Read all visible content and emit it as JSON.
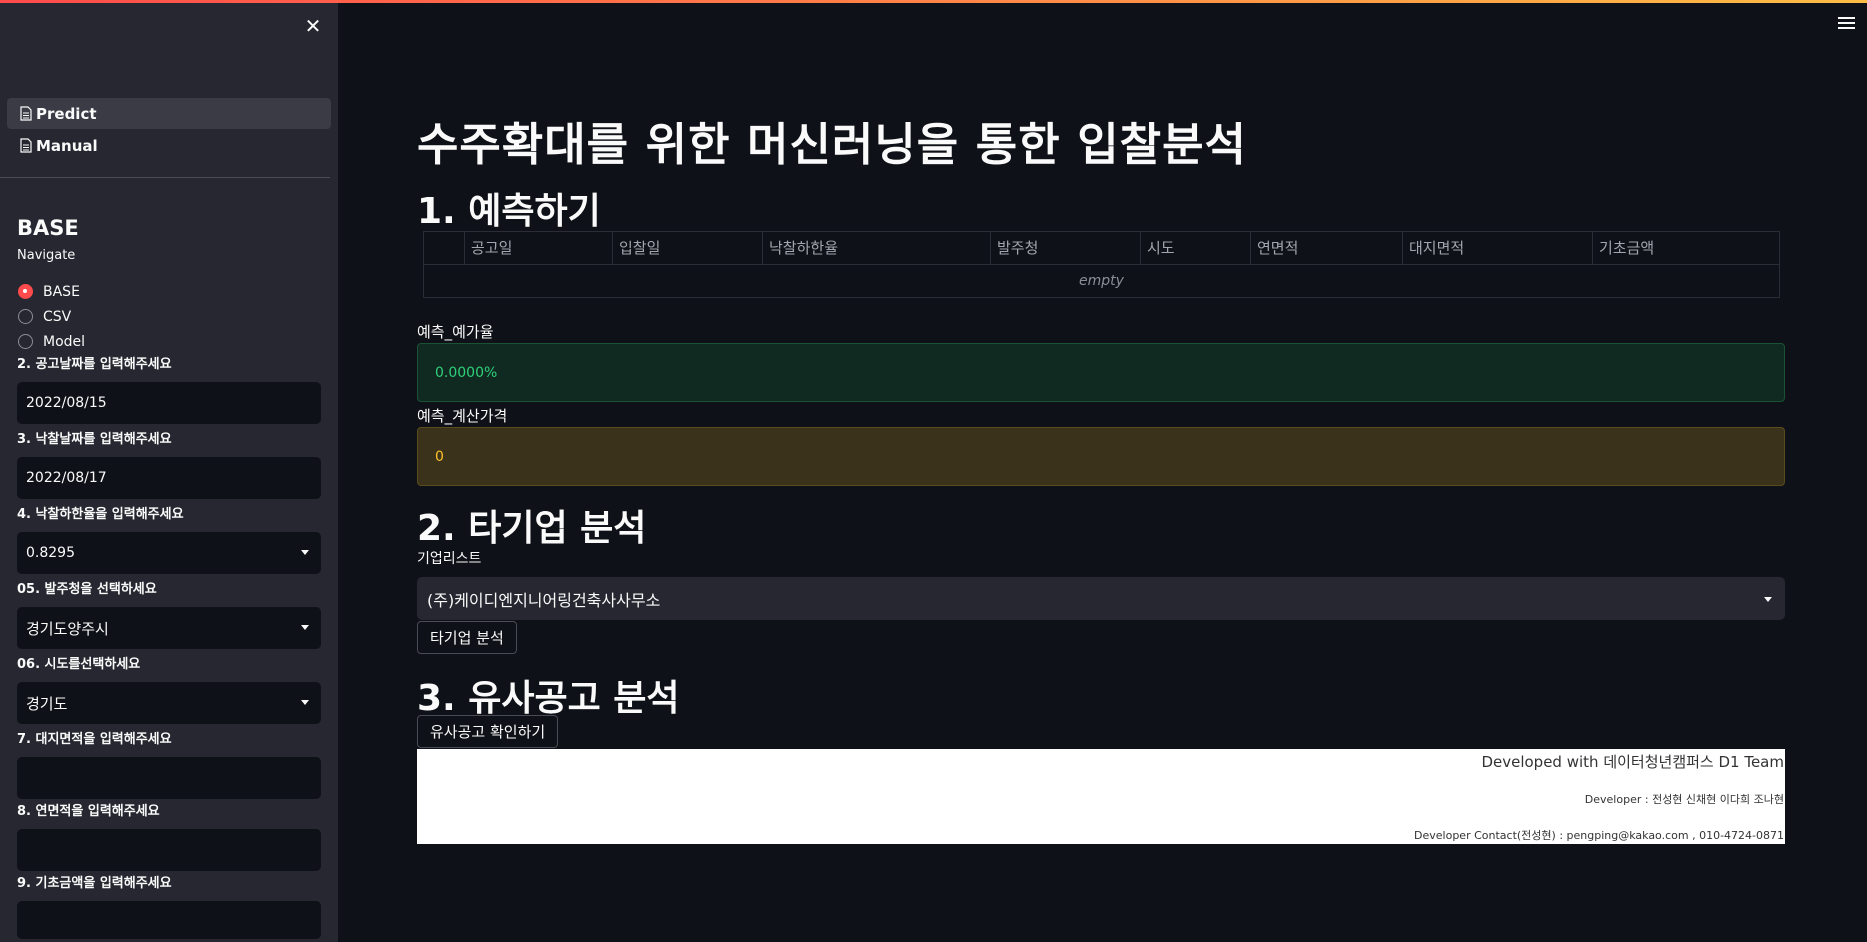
{
  "sidebar": {
    "nav": [
      {
        "label": "Predict",
        "active": true
      },
      {
        "label": "Manual",
        "active": false
      }
    ],
    "title": "BASE",
    "navigate_label": "Navigate",
    "radio_options": [
      "BASE",
      "CSV",
      "Model"
    ],
    "radio_selected": "BASE",
    "fields": [
      {
        "label": "2. 공고날짜를 입력해주세요",
        "value": "2022/08/15"
      },
      {
        "label": "3. 낙찰날짜를 입력해주세요",
        "value": "2022/08/17"
      },
      {
        "label": "4. 낙찰하한율을 입력해주세요",
        "value": "0.8295"
      },
      {
        "label": "05. 발주청을 선택하세요",
        "value": "경기도양주시"
      },
      {
        "label": "06. 시도를선택하세요",
        "value": "경기도"
      },
      {
        "label": "7. 대지면적을 입력해주세요",
        "value": ""
      },
      {
        "label": "8. 연면적을 입력해주세요",
        "value": ""
      },
      {
        "label": "9. 기초금액을 입력해주세요",
        "value": ""
      }
    ]
  },
  "main": {
    "title": "수주확대를 위한 머신러닝을 통한 입찰분석",
    "section1": "1. 예측하기",
    "table": {
      "columns": [
        "공고일",
        "입찰일",
        "낙찰하한율",
        "발주청",
        "시도",
        "연면적",
        "대지면적",
        "기초금액"
      ],
      "empty_text": "empty"
    },
    "metric1_label": "예측_예가율",
    "metric1_value": "0.0000%",
    "metric2_label": "예측_계산가격",
    "metric2_value": "0",
    "section2": "2. 타기업 분석",
    "company_list_label": "기업리스트",
    "company_selected": "(주)케이디엔지니어링건축사사무소",
    "company_button": "타기업 분석",
    "section3": "3. 유사공고 분석",
    "similar_button": "유사공고 확인하기",
    "footer": {
      "line1": "Developed with 데이터청년캠퍼스 D1 Team",
      "line2": "Developer : 전성현 신채현 이다희 조나현",
      "line3": "Developer Contact(전성현) : pengping@kakao.com , 010-4724-0871"
    }
  },
  "colors": {
    "accent": "#ff4b4b",
    "success": "#2fd07a",
    "warning": "#ffc228"
  }
}
